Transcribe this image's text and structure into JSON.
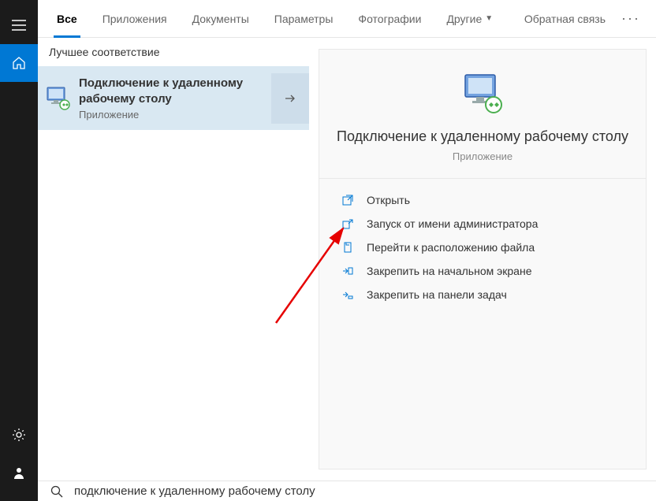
{
  "leftRail": {
    "menu": "menu",
    "home": "home",
    "settings": "settings",
    "account": "account"
  },
  "tabs": {
    "items": [
      {
        "label": "Все",
        "active": true
      },
      {
        "label": "Приложения",
        "active": false
      },
      {
        "label": "Документы",
        "active": false
      },
      {
        "label": "Параметры",
        "active": false
      },
      {
        "label": "Фотографии",
        "active": false
      },
      {
        "label": "Другие",
        "active": false,
        "dropdown": true
      }
    ],
    "feedback": "Обратная связь",
    "more": "···"
  },
  "results": {
    "sectionHeader": "Лучшее соответствие",
    "bestMatch": {
      "title": "Подключение к удаленному рабочему столу",
      "subtitle": "Приложение"
    }
  },
  "details": {
    "title": "Подключение к удаленному рабочему столу",
    "subtitle": "Приложение",
    "actions": [
      {
        "label": "Открыть",
        "icon": "open"
      },
      {
        "label": "Запуск от имени администратора",
        "icon": "admin"
      },
      {
        "label": "Перейти к расположению файла",
        "icon": "folder"
      },
      {
        "label": "Закрепить на начальном экране",
        "icon": "pinstart"
      },
      {
        "label": "Закрепить на панели задач",
        "icon": "pintask"
      }
    ]
  },
  "search": {
    "value": "подключение к удаленному рабочему столу"
  }
}
